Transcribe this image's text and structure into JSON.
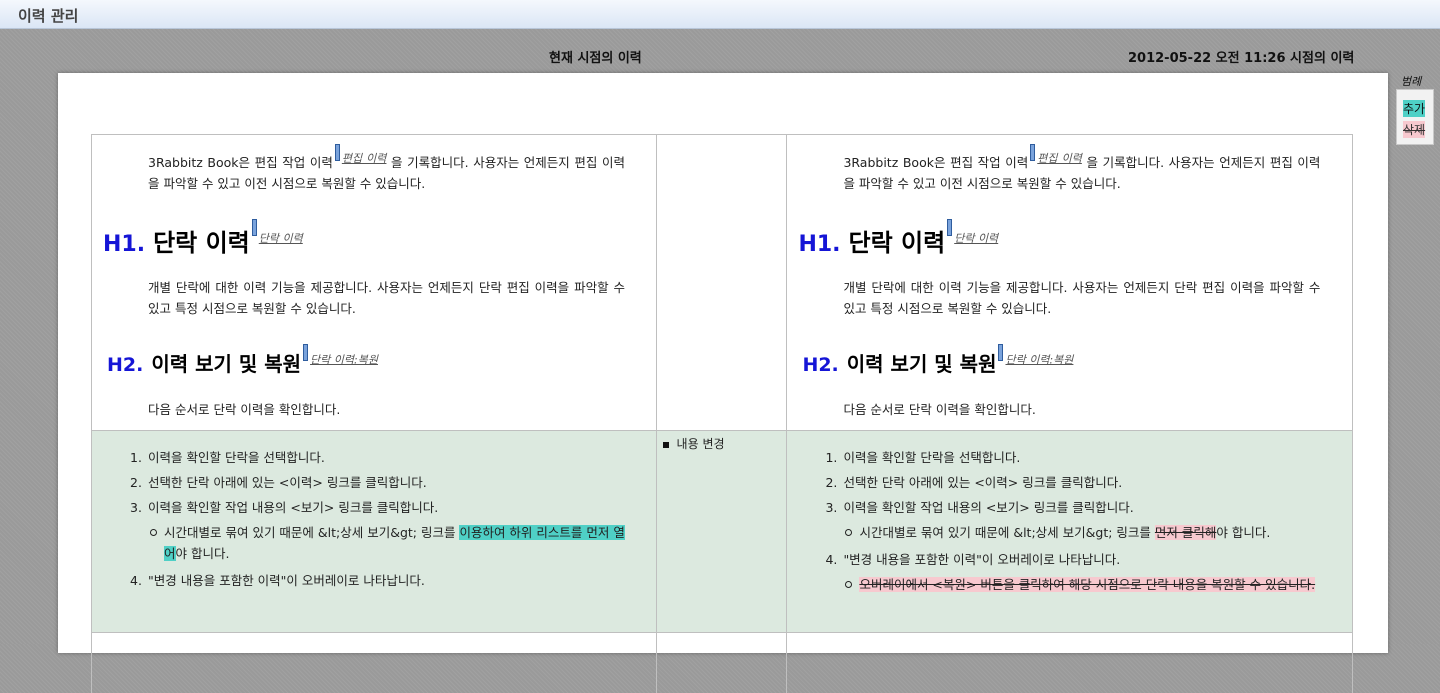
{
  "window": {
    "title": "이력 관리"
  },
  "columns": {
    "current": "현재 시점의 이력",
    "past": "2012-05-22 오전 11:26 시점의 이력"
  },
  "legend": {
    "title": "범례",
    "add": "추가",
    "del": "삭제"
  },
  "doc": {
    "intro_text": "3Rabbitz Book은 편집 작업 이력",
    "intro_ref": "편집 이력",
    "intro_text2": " 을 기록합니다. 사용자는 언제든지 편집 이력을 파악할 수 있고 이전 시점으로 복원할 수 있습니다.",
    "h1_label": "H1.",
    "h1_text": "단락 이력",
    "h1_ref": "단락 이력",
    "para2": "개별 단락에 대한 이력 기능을 제공합니다. 사용자는 언제든지 단락 편집 이력을 파악할 수 있고 특정 시점으로 복원할 수 있습니다.",
    "h2_label": "H2.",
    "h2_text": "이력 보기 및 복원",
    "h2_ref": "단락 이력:복원",
    "para3": "다음 순서로 단락 이력을 확인합니다."
  },
  "change_note": "내용 변경",
  "current_list": {
    "item1": "이력을 확인할 단락을 선택합니다.",
    "item2": "선택한 단락 아래에 있는 <이력> 링크를 클릭합니다.",
    "item3": "이력을 확인할 작업 내용의 <보기> 링크를 클릭합니다.",
    "sub_pre": "시간대별로 묶여 있기 때문에 &lt;상세 보기&gt; 링크를 ",
    "sub_added": "이용하여 하위 리스트를 먼저 열어",
    "sub_post": "야 합니다.",
    "item4": "\"변경 내용을 포함한 이력\"이 오버레이로 나타납니다."
  },
  "past_list": {
    "item1": "이력을 확인할 단락을 선택합니다.",
    "item2": "선택한 단락 아래에 있는 <이력> 링크를 클릭합니다.",
    "item3": "이력을 확인할 작업 내용의 <보기> 링크를 클릭합니다.",
    "sub3_pre": "시간대별로 묶여 있기 때문에 &lt;상세 보기&gt; 링크를 ",
    "sub3_deleted": "먼저 클릭해",
    "sub3_post": "야 합니다.",
    "item4": "\"변경 내용을 포함한 이력\"이 오버레이로 나타납니다.",
    "sub4_deleted": "오버레이에서 <복원> 버튼을 클릭하여 해당 시점으로 단락 내용을 복원할 수 있습니다."
  },
  "colors": {
    "added": "#4fd0c6",
    "deleted": "#f7c9cf",
    "changed_row": "#dce9df",
    "heading_label": "#1515d6"
  }
}
